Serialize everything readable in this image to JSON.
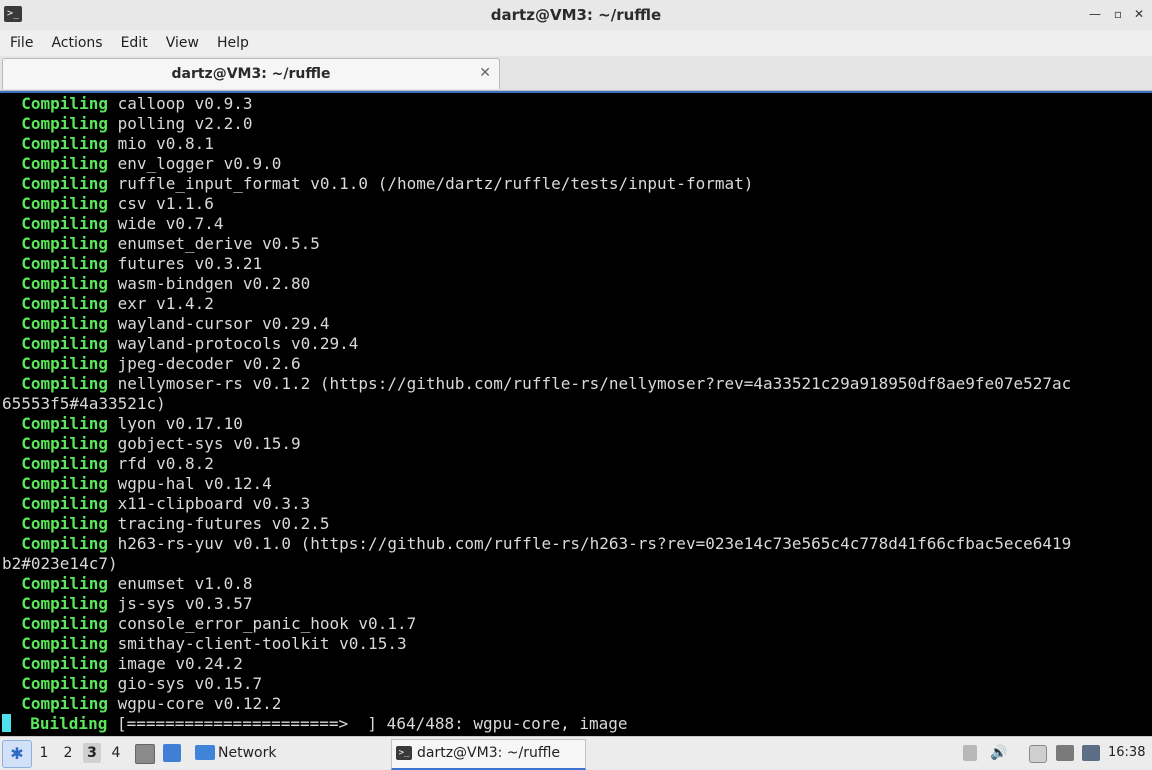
{
  "window": {
    "title": "dartz@VM3: ~/ruffle",
    "app_icon_glyph": ">_",
    "minimize_glyph": "—",
    "restore_glyph": "▫",
    "close_glyph": "✕"
  },
  "menu": [
    "File",
    "Actions",
    "Edit",
    "View",
    "Help"
  ],
  "tab": {
    "label": "dartz@VM3: ~/ruffle",
    "close_glyph": "✕"
  },
  "terminal": {
    "keyword_color": "#5ae85a",
    "lines": [
      [
        "  Compiling",
        " calloop v0.9.3"
      ],
      [
        "  Compiling",
        " polling v2.2.0"
      ],
      [
        "  Compiling",
        " mio v0.8.1"
      ],
      [
        "  Compiling",
        " env_logger v0.9.0"
      ],
      [
        "  Compiling",
        " ruffle_input_format v0.1.0 (/home/dartz/ruffle/tests/input-format)"
      ],
      [
        "  Compiling",
        " csv v1.1.6"
      ],
      [
        "  Compiling",
        " wide v0.7.4"
      ],
      [
        "  Compiling",
        " enumset_derive v0.5.5"
      ],
      [
        "  Compiling",
        " futures v0.3.21"
      ],
      [
        "  Compiling",
        " wasm-bindgen v0.2.80"
      ],
      [
        "  Compiling",
        " exr v1.4.2"
      ],
      [
        "  Compiling",
        " wayland-cursor v0.29.4"
      ],
      [
        "  Compiling",
        " wayland-protocols v0.29.4"
      ],
      [
        "  Compiling",
        " jpeg-decoder v0.2.6"
      ],
      [
        "  Compiling",
        " nellymoser-rs v0.1.2 (https://github.com/ruffle-rs/nellymoser?rev=4a33521c29a918950df8ae9fe07e527ac"
      ],
      [
        "",
        "65553f5#4a33521c)"
      ],
      [
        "  Compiling",
        " lyon v0.17.10"
      ],
      [
        "  Compiling",
        " gobject-sys v0.15.9"
      ],
      [
        "  Compiling",
        " rfd v0.8.2"
      ],
      [
        "  Compiling",
        " wgpu-hal v0.12.4"
      ],
      [
        "  Compiling",
        " x11-clipboard v0.3.3"
      ],
      [
        "  Compiling",
        " tracing-futures v0.2.5"
      ],
      [
        "  Compiling",
        " h263-rs-yuv v0.1.0 (https://github.com/ruffle-rs/h263-rs?rev=023e14c73e565c4c778d41f66cfbac5ece6419"
      ],
      [
        "",
        "b2#023e14c7)"
      ],
      [
        "  Compiling",
        " enumset v1.0.8"
      ],
      [
        "  Compiling",
        " js-sys v0.3.57"
      ],
      [
        "  Compiling",
        " console_error_panic_hook v0.1.7"
      ],
      [
        "  Compiling",
        " smithay-client-toolkit v0.15.3"
      ],
      [
        "  Compiling",
        " image v0.24.2"
      ],
      [
        "  Compiling",
        " gio-sys v0.15.7"
      ],
      [
        "  Compiling",
        " wgpu-core v0.12.2"
      ]
    ],
    "status_keyword": "   Building",
    "status_text": " [======================>  ] 464/488: wgpu-core, image"
  },
  "taskbar": {
    "workspaces": [
      "1",
      "2",
      "3",
      "4"
    ],
    "active_workspace": "3",
    "network_label": "Network",
    "task_label": "dartz@VM3: ~/ruffle",
    "volume_glyph": "🔊",
    "clock": "16:38"
  }
}
